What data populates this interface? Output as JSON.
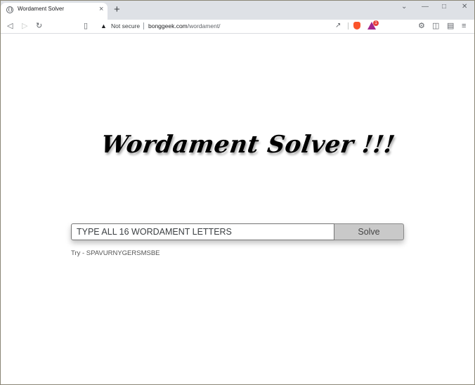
{
  "browser": {
    "tab_title": "Wordament Solver",
    "tab_close": "×",
    "new_tab": "+",
    "not_secure": "Not secure",
    "url_host": "bonggeek.com",
    "url_path": "/wordament/",
    "notification_count": "1",
    "icons": [
      "back-icon",
      "forward-icon",
      "reload-icon",
      "bookmark-icon",
      "warning-icon",
      "share-icon",
      "brave-shields-icon",
      "brave-rewards-icon",
      "extensions-icon",
      "sidebar-icon",
      "wallet-icon",
      "menu-icon"
    ]
  },
  "page": {
    "title": "Wordament Solver !!!",
    "input_placeholder": "TYPE ALL 16 WORDAMENT LETTERS",
    "solve_label": "Solve",
    "try_hint": "Try - SPAVURNYGERSMSBE"
  },
  "colors": {
    "tab_strip": "#dee1e6",
    "solve_button": "#c9c9c9",
    "brave_orange": "#fb542b",
    "rewards_purple": "#a3278f"
  }
}
